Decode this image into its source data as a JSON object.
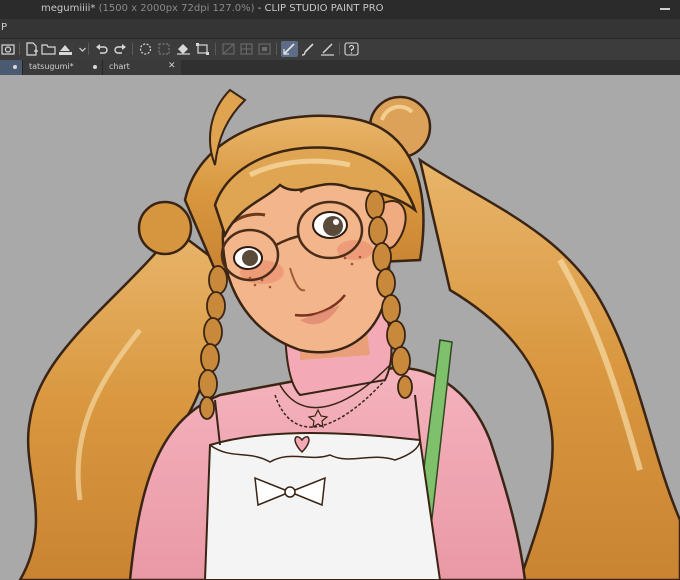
{
  "window": {
    "doc_name": "megumiiii*",
    "doc_info": "(1500 x 2000px 72dpi 127.0%)",
    "separator": " - ",
    "app_name": "CLIP STUDIO PAINT PRO"
  },
  "menu": {
    "first_letter": "P"
  },
  "toolbar": {
    "icons": [
      "camera-icon",
      "new-file-icon",
      "open-folder-icon",
      "save-icon",
      "undo-icon",
      "redo-icon",
      "select-all-icon",
      "deselect-icon",
      "fill-icon",
      "transform-icon",
      "snap-ruler-icon",
      "snap-special-ruler-icon",
      "snap-grid-icon",
      "pen-pressure-icon",
      "brush-icon",
      "ruler-pen-icon",
      "help-icon"
    ],
    "active_icon": "pen-pressure-icon"
  },
  "tabs": [
    {
      "label": "",
      "modified": true,
      "active": true
    },
    {
      "label": "tatsugumi*",
      "modified": true,
      "active": false
    },
    {
      "label": "chart",
      "modified": false,
      "active": false,
      "close": "✕"
    }
  ],
  "colors": {
    "canvas_bg": "#a9a9a9",
    "hair": "#d99a4a",
    "skin": "#f3b68a",
    "sweater": "#f0a3b0",
    "strap": "#7fc06a",
    "accent_tab": "#4a5a70"
  }
}
